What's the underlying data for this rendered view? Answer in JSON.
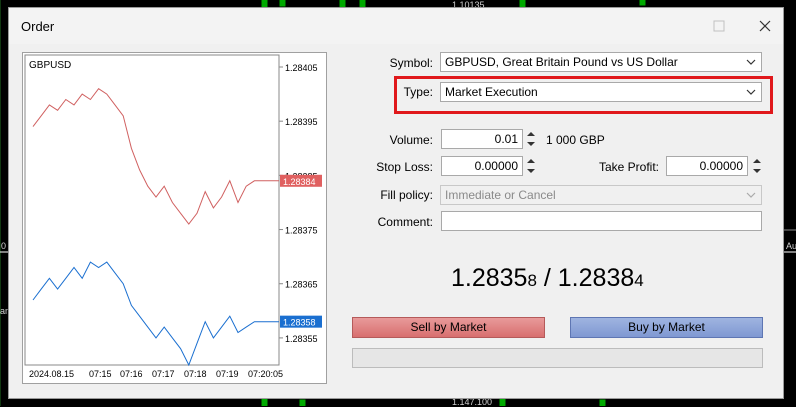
{
  "background": {
    "price_top": "1.10135",
    "price_bottom": "1.147.100",
    "left_edge": "0",
    "right_edge": "Aug",
    "left_label": "ant"
  },
  "dialog": {
    "title": "Order",
    "minimize_icon": "minimize-icon",
    "close_icon": "close-icon"
  },
  "mini_chart": {
    "symbol": "GBPUSD",
    "bid_label": "1.28384",
    "ask_label": "1.28358",
    "bid_color": "#e06060",
    "ask_color": "#1a6fd0"
  },
  "chart_data": {
    "type": "line",
    "x_ticks": [
      "2024.08.15",
      "07:15",
      "07:16",
      "07:17",
      "07:18",
      "07:19",
      "07:20:05"
    ],
    "y_ticks": [
      "1.28405",
      "1.28395",
      "1.28385",
      "1.28375",
      "1.28365",
      "1.28355"
    ],
    "ylim": [
      1.2835,
      1.28405
    ],
    "series": [
      {
        "color": "#d06060",
        "values": [
          1.28394,
          1.28396,
          1.28398,
          1.28397,
          1.28399,
          1.28398,
          1.284,
          1.28399,
          1.28401,
          1.284,
          1.28398,
          1.28396,
          1.2839,
          1.28386,
          1.28383,
          1.28381,
          1.28383,
          1.2838,
          1.28378,
          1.28376,
          1.28378,
          1.28382,
          1.28379,
          1.28381,
          1.28384,
          1.2838,
          1.28383,
          1.28384,
          1.28384,
          1.28384,
          1.28384
        ]
      },
      {
        "color": "#1a6fd0",
        "values": [
          1.28362,
          1.28364,
          1.28366,
          1.28364,
          1.28366,
          1.28368,
          1.28366,
          1.28369,
          1.28368,
          1.28369,
          1.28367,
          1.28365,
          1.28361,
          1.28359,
          1.28357,
          1.28355,
          1.28357,
          1.28355,
          1.28353,
          1.2835,
          1.28354,
          1.28358,
          1.28355,
          1.28357,
          1.28359,
          1.28356,
          1.28357,
          1.28358,
          1.28358,
          1.28358,
          1.28358
        ]
      }
    ]
  },
  "form": {
    "symbol_label": "Symbol:",
    "symbol_value": "GBPUSD, Great Britain Pound vs US Dollar",
    "type_label": "Type:",
    "type_value": "Market Execution",
    "volume_label": "Volume:",
    "volume_value": "0.01",
    "volume_unit": "1 000 GBP",
    "stop_loss_label": "Stop Loss:",
    "stop_loss_value": "0.00000",
    "take_profit_label": "Take Profit:",
    "take_profit_value": "0.00000",
    "fill_policy_label": "Fill policy:",
    "fill_policy_value": "Immediate or Cancel",
    "comment_label": "Comment:",
    "comment_value": ""
  },
  "quote": {
    "bid_main": "1.2835",
    "bid_small": "8",
    "separator": " / ",
    "ask_main": "1.2838",
    "ask_small": "4"
  },
  "actions": {
    "sell_label": "Sell by Market",
    "buy_label": "Buy by Market"
  },
  "colors": {
    "highlight": "#e0181b",
    "sell_button": "#d86f6f",
    "buy_button": "#7f98d2"
  }
}
